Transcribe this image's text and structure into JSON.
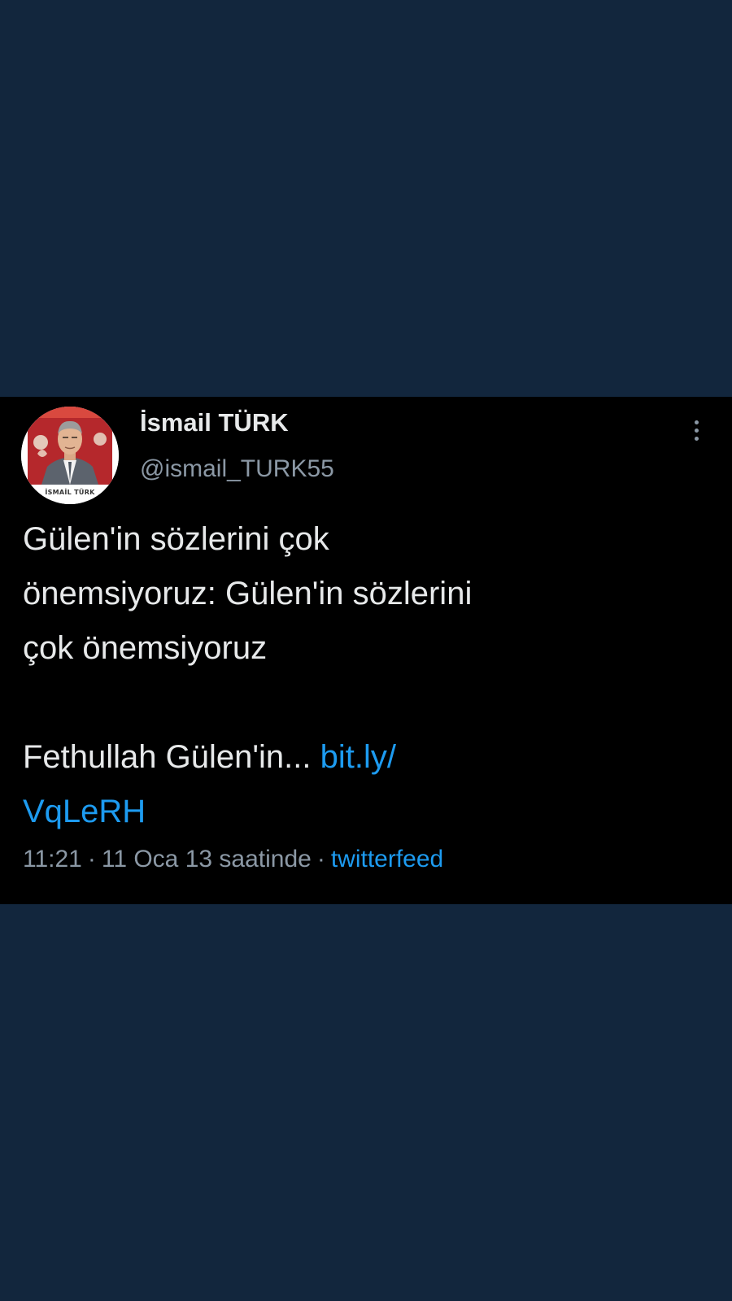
{
  "tweet": {
    "author": {
      "display_name": "İsmail TÜRK",
      "handle": "@ismail_TURK55",
      "avatar_caption": "İSMAİL TÜRK"
    },
    "text": {
      "line1": "Gülen'in sözlerini çok",
      "line2": "önemsiyoruz: Gülen'in sözlerini",
      "line3": "çok önemsiyoruz",
      "line4_prefix": "Fethullah Gülen'in... ",
      "link_part1": "bit.ly/",
      "link_part2": "VqLeRH"
    },
    "meta": {
      "time": "11:21",
      "date": "11 Oca 13 saatinde",
      "separator": "·",
      "source": "twitterfeed"
    },
    "more_icon": "more-vertical-icon"
  },
  "colors": {
    "page_background": "#12263d",
    "card_background": "#000000",
    "primary_text": "#e7e9ea",
    "secondary_text": "#8b98a5",
    "link": "#1d9bf0"
  }
}
